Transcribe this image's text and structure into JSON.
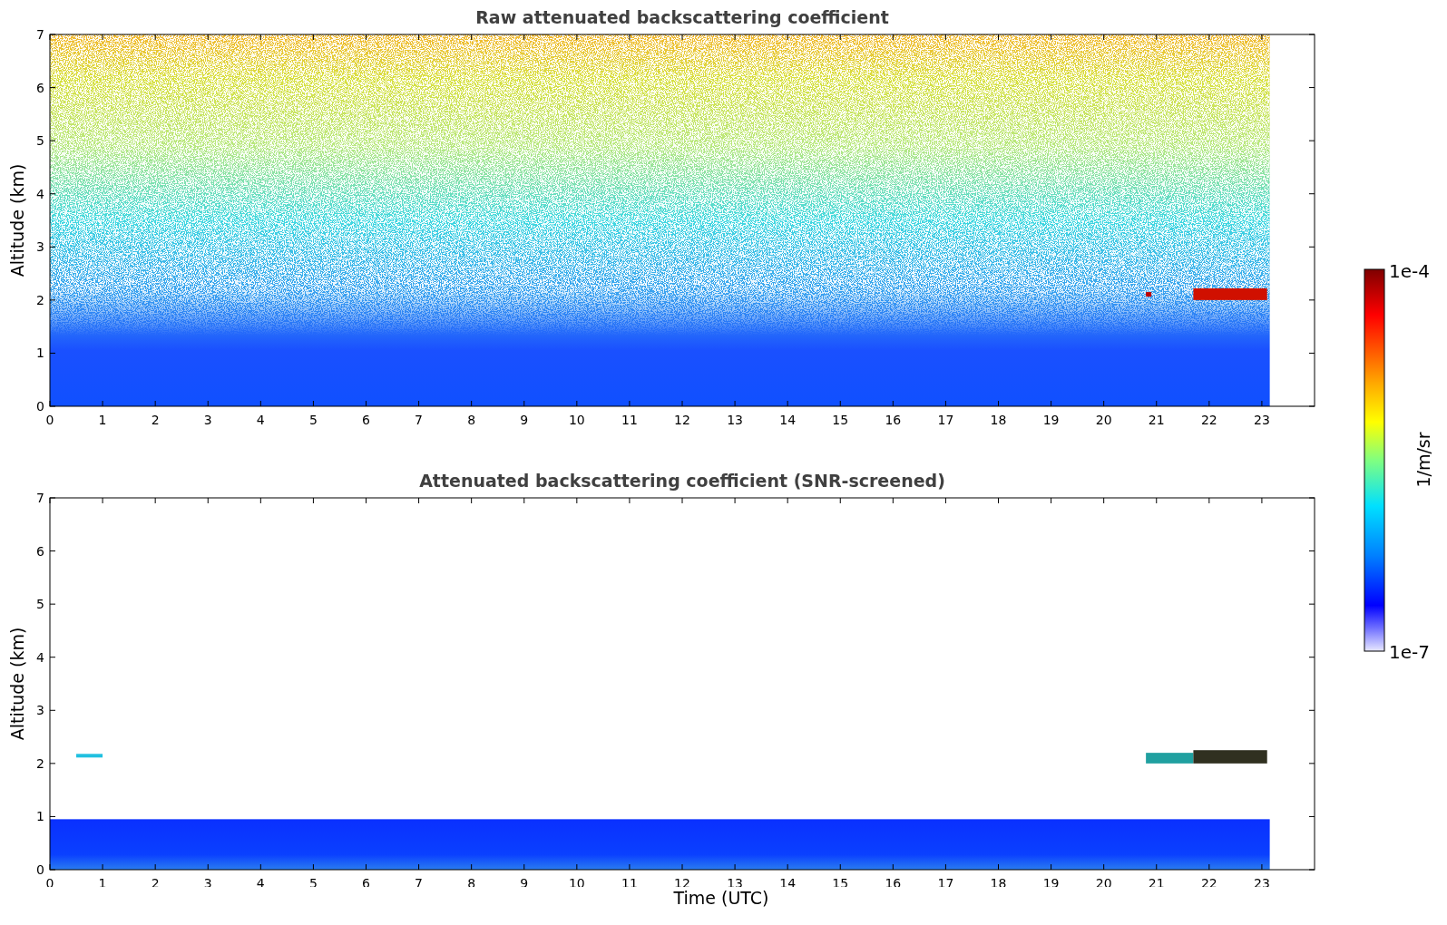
{
  "panels": [
    {
      "kind": "raw",
      "title": "Raw attenuated backscattering coefficient",
      "ylabel": "Altitude (km)",
      "yticks": [
        "7",
        "6",
        "5",
        "4",
        "3",
        "2",
        "1",
        "0"
      ],
      "xticks": [
        "0",
        "1",
        "2",
        "3",
        "4",
        "5",
        "6",
        "7",
        "8",
        "9",
        "10",
        "11",
        "12",
        "13",
        "14",
        "15",
        "16",
        "17",
        "18",
        "19",
        "20",
        "21",
        "22",
        "23"
      ]
    },
    {
      "kind": "screened",
      "title": "Attenuated backscattering coefficient (SNR-screened)",
      "ylabel": "Altitude (km)",
      "yticks": [
        "7",
        "6",
        "5",
        "4",
        "3",
        "2",
        "1",
        "0"
      ],
      "xticks": [
        "0",
        "1",
        "2",
        "3",
        "4",
        "5",
        "6",
        "7",
        "8",
        "9",
        "10",
        "11",
        "12",
        "13",
        "14",
        "15",
        "16",
        "17",
        "18",
        "19",
        "20",
        "21",
        "22",
        "23"
      ]
    }
  ],
  "xlabel": "Time (UTC)",
  "colorbar": {
    "max_label": "1e-4",
    "min_label": "1e-7",
    "unit": "1/m/sr"
  }
}
